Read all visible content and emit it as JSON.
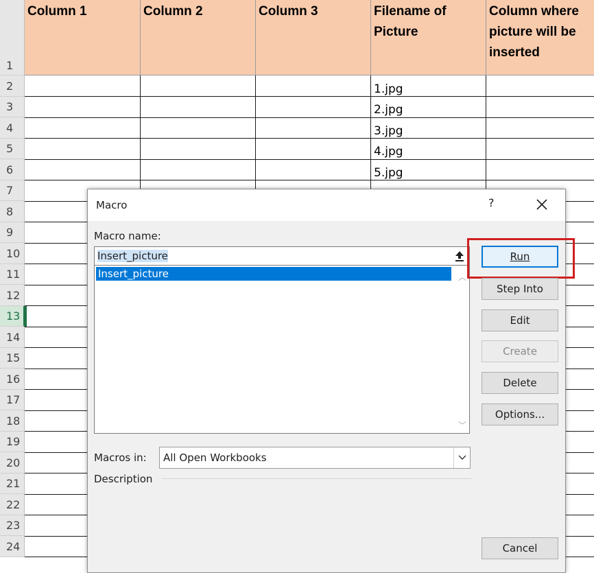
{
  "sheet": {
    "headers": [
      "Column 1",
      "Column 2",
      "Column 3",
      "Filename of Picture",
      "Column where picture will be inserted"
    ],
    "rows": [
      "1",
      "2",
      "3",
      "4",
      "5",
      "6",
      "7",
      "8",
      "9",
      "10",
      "11",
      "12",
      "13",
      "14",
      "15",
      "16",
      "17",
      "18",
      "19",
      "20",
      "21",
      "22",
      "23",
      "24"
    ],
    "active_row": "13",
    "filenames": [
      "1.jpg",
      "2.jpg",
      "3.jpg",
      "4.jpg",
      "5.jpg"
    ],
    "header_color": "#f8cbad"
  },
  "dialog": {
    "title": "Macro",
    "help": "?",
    "macro_name_label": "Macro name:",
    "macro_name_value": "Insert_picture",
    "macro_list": [
      "Insert_picture"
    ],
    "buttons": {
      "run": "Run",
      "step_into": "Step Into",
      "edit": "Edit",
      "create": "Create",
      "delete": "Delete",
      "options": "Options...",
      "cancel": "Cancel"
    },
    "macros_in_label": "Macros in:",
    "macros_in_value": "All Open Workbooks",
    "description_label": "Description",
    "accent": "#0078d7",
    "highlight_color": "#d01f1f"
  }
}
